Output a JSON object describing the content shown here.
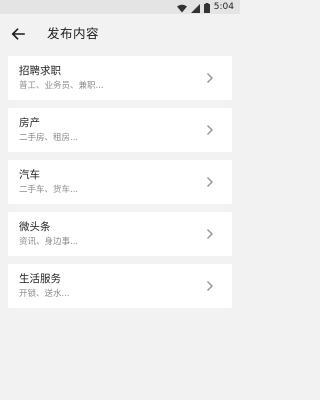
{
  "status_bar": {
    "time": "5:04",
    "icons": [
      "wifi-icon",
      "signal-icon",
      "battery-icon"
    ]
  },
  "app_bar": {
    "back_icon": "arrow-left-icon",
    "title": "发布内容"
  },
  "categories": [
    {
      "title": "招聘求职",
      "subtitle": "普工、业务员、兼职..."
    },
    {
      "title": "房产",
      "subtitle": "二手房、租房..."
    },
    {
      "title": "汽车",
      "subtitle": "二手车、货车..."
    },
    {
      "title": "微头条",
      "subtitle": "资讯、身边事..."
    },
    {
      "title": "生活服务",
      "subtitle": "开锁、送水..."
    }
  ],
  "colors": {
    "background": "#f2f2f2",
    "card": "#ffffff",
    "title_text": "#1f1f1f",
    "subtitle_text": "#8c8c8c",
    "chevron": "#9a9a9a"
  }
}
